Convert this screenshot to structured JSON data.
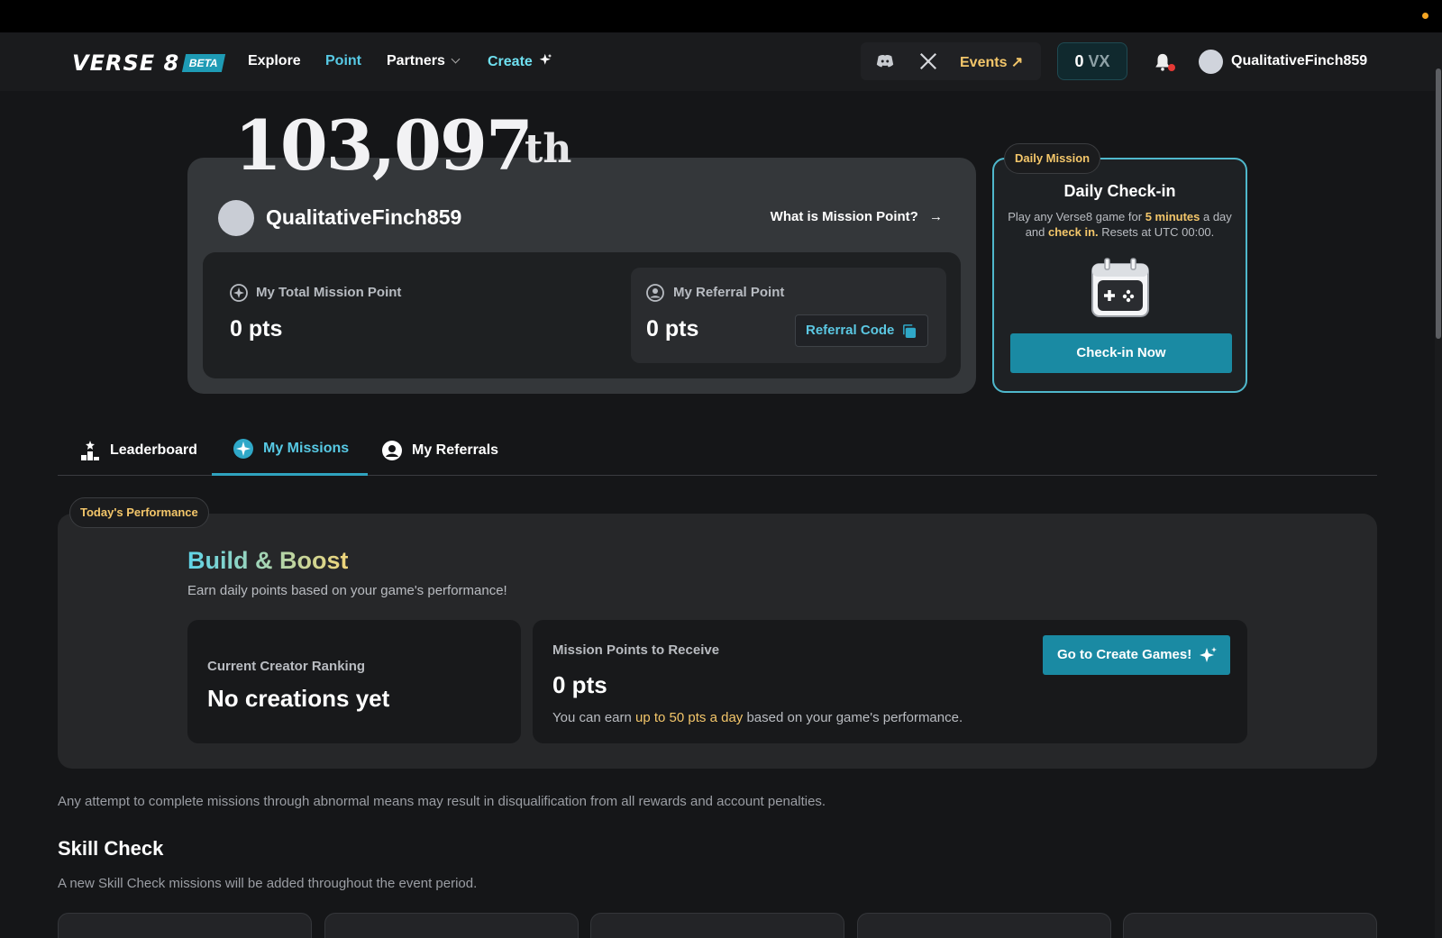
{
  "nav": {
    "logo": "VERSE 8",
    "beta": "BETA",
    "links": {
      "explore": "Explore",
      "point": "Point",
      "partners": "Partners",
      "create": "Create"
    },
    "events": "Events ↗",
    "vx_amount": "0",
    "vx_unit": "VX",
    "username": "QualitativeFinch859",
    "accent": "#57c9e4"
  },
  "rank": {
    "value": "103,097",
    "suffix": "th"
  },
  "profile": {
    "username": "QualitativeFinch859",
    "what_link": "What is Mission Point?",
    "total_label": "My Total Mission Point",
    "total_value": "0 pts",
    "referral_label": "My Referral Point",
    "referral_value": "0 pts",
    "referral_code_btn": "Referral Code"
  },
  "daily": {
    "badge": "Daily Mission",
    "title": "Daily Check-in",
    "desc_1": "Play any Verse8 game for ",
    "desc_hl1": "5 minutes",
    "desc_2": " a day and ",
    "desc_hl2": "check in.",
    "desc_3": " Resets at UTC 00:00.",
    "button": "Check-in Now",
    "border_color": "#4fb8cc"
  },
  "tabs": {
    "leaderboard": "Leaderboard",
    "my_missions": "My Missions",
    "my_referrals": "My Referrals",
    "active": "My Missions"
  },
  "performance": {
    "badge": "Today's Performance",
    "title": "Build & Boost",
    "subtitle": "Earn daily points based on your game's performance!",
    "ranking_label": "Current Creator Ranking",
    "ranking_value": "No creations yet",
    "mp_label": "Mission Points to Receive",
    "mp_value": "0 pts",
    "mp_note_1": "You can earn ",
    "mp_note_hl": "up to 50 pts a day",
    "mp_note_2": " based on your game's performance.",
    "create_btn": "Go to Create Games!"
  },
  "warning": "Any attempt to complete missions through abnormal means may result in disqualification from all rewards and account penalties.",
  "skill_check": {
    "title": "Skill Check",
    "subtitle": "A new Skill Check missions will be added throughout the event period."
  }
}
